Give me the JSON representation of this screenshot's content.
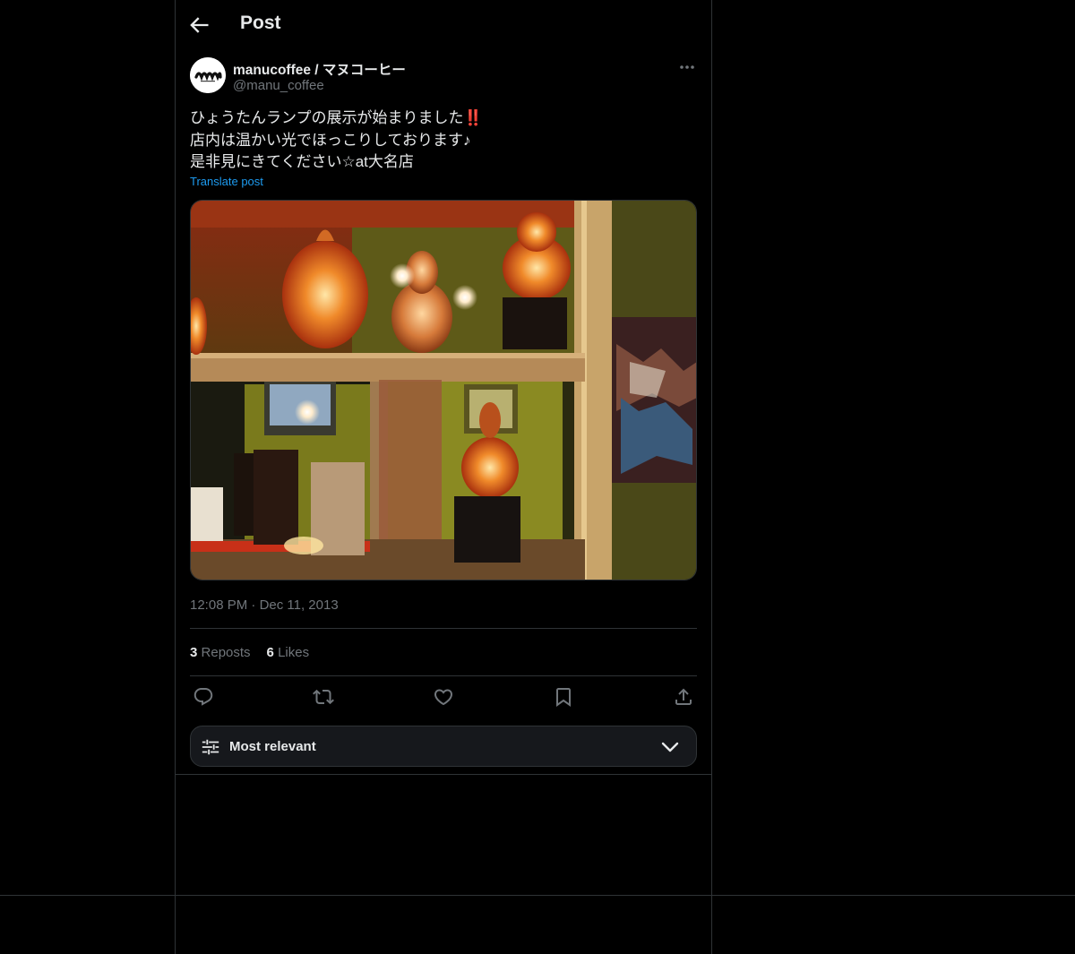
{
  "header": {
    "title": "Post"
  },
  "post": {
    "author_name": "manucoffee / マヌコーヒー",
    "author_handle": "@manu_coffee",
    "avatar_text": "mm",
    "text_line1": "ひょうたんランプの展示が始まりました‼️",
    "text_line2": "店内は温かい光でほっこりしております♪",
    "text_line3": "是非見にきてください☆at大名店",
    "translate_label": "Translate post",
    "time": "12:08 PM",
    "separator": "·",
    "date": "Dec 11, 2013",
    "reposts_count": "3",
    "reposts_label": "Reposts",
    "likes_count": "6",
    "likes_label": "Likes"
  },
  "icons": {
    "back": "arrow-left-icon",
    "more": "more-horizontal-icon",
    "reply": "reply-icon",
    "repost": "repost-icon",
    "like": "heart-icon",
    "bookmark": "bookmark-icon",
    "share": "share-icon",
    "sort": "sliders-icon",
    "chevron": "chevron-down-icon"
  },
  "sort": {
    "label": "Most relevant"
  },
  "colors": {
    "background": "#000000",
    "accent": "#1d9bf0",
    "muted": "#71767b",
    "border": "#2f3336"
  }
}
